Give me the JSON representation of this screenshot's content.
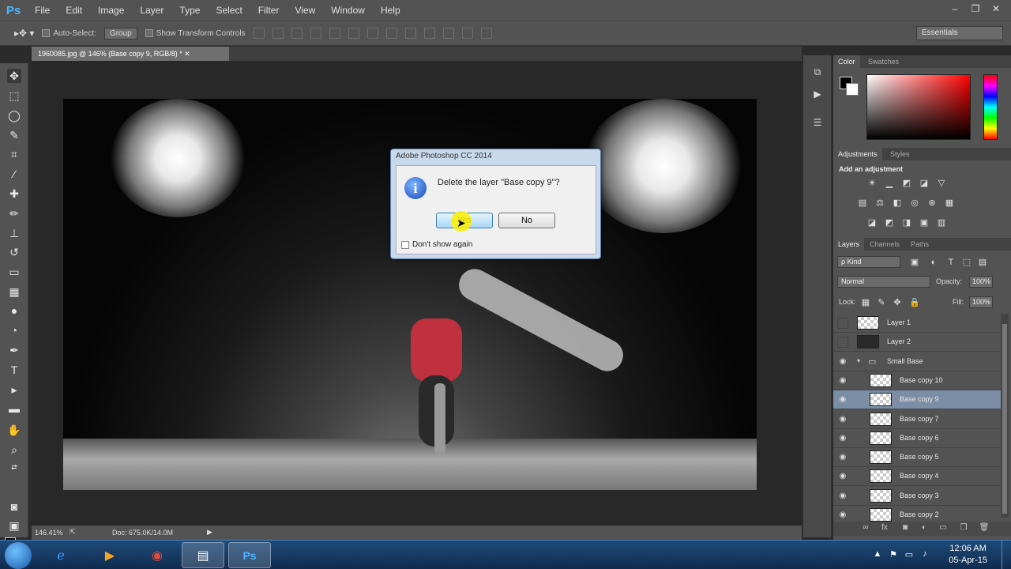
{
  "menu": {
    "logo": "Ps",
    "items": [
      "File",
      "Edit",
      "Image",
      "Layer",
      "Type",
      "Select",
      "Filter",
      "View",
      "Window",
      "Help"
    ],
    "win_controls": [
      "–",
      "❐",
      "✕"
    ]
  },
  "options_bar": {
    "auto_select_label": "Auto-Select:",
    "group_value": "Group",
    "show_transform_label": "Show Transform Controls",
    "workspace": "Essentials"
  },
  "document": {
    "tab_title": "1960085.jpg @ 146% (Base copy 9, RGB/8) *",
    "zoom_readout": "146.41%",
    "doc_size": "Doc: 675.0K/14.0M"
  },
  "dialog": {
    "title": "Adobe Photoshop CC 2014",
    "message": "Delete the layer \"Base copy 9\"?",
    "yes_label": "Yes",
    "no_label": "No",
    "dont_show_label": "Don't show again"
  },
  "panels": {
    "color_tabs": [
      "Color",
      "Swatches"
    ],
    "adjust_tabs": [
      "Adjustments",
      "Styles"
    ],
    "adjust_heading": "Add an adjustment",
    "layers_tabs": [
      "Layers",
      "Channels",
      "Paths"
    ],
    "kind_filter": "ρ Kind",
    "blend_mode": "Normal",
    "opacity_label": "Opacity:",
    "opacity_value": "100%",
    "lock_label": "Lock:",
    "fill_label": "Fill:",
    "fill_value": "100%"
  },
  "layers": [
    {
      "name": "Layer 1",
      "visible": false,
      "thumb": "checker",
      "indent": 0
    },
    {
      "name": "Layer 2",
      "visible": false,
      "thumb": "dark",
      "indent": 0
    },
    {
      "name": "Small Base",
      "visible": true,
      "thumb": "folder",
      "indent": 0
    },
    {
      "name": "Base copy 10",
      "visible": true,
      "thumb": "checker",
      "indent": 1
    },
    {
      "name": "Base copy 9",
      "visible": true,
      "thumb": "checker",
      "indent": 1,
      "selected": true
    },
    {
      "name": "Base copy 7",
      "visible": true,
      "thumb": "checker",
      "indent": 1
    },
    {
      "name": "Base copy 6",
      "visible": true,
      "thumb": "checker",
      "indent": 1
    },
    {
      "name": "Base copy 5",
      "visible": true,
      "thumb": "checker",
      "indent": 1
    },
    {
      "name": "Base copy 4",
      "visible": true,
      "thumb": "checker",
      "indent": 1
    },
    {
      "name": "Base copy 3",
      "visible": true,
      "thumb": "checker",
      "indent": 1
    },
    {
      "name": "Base copy 2",
      "visible": true,
      "thumb": "checker",
      "indent": 1
    }
  ],
  "taskbar": {
    "time": "12:06 AM",
    "date": "05-Apr-15"
  }
}
